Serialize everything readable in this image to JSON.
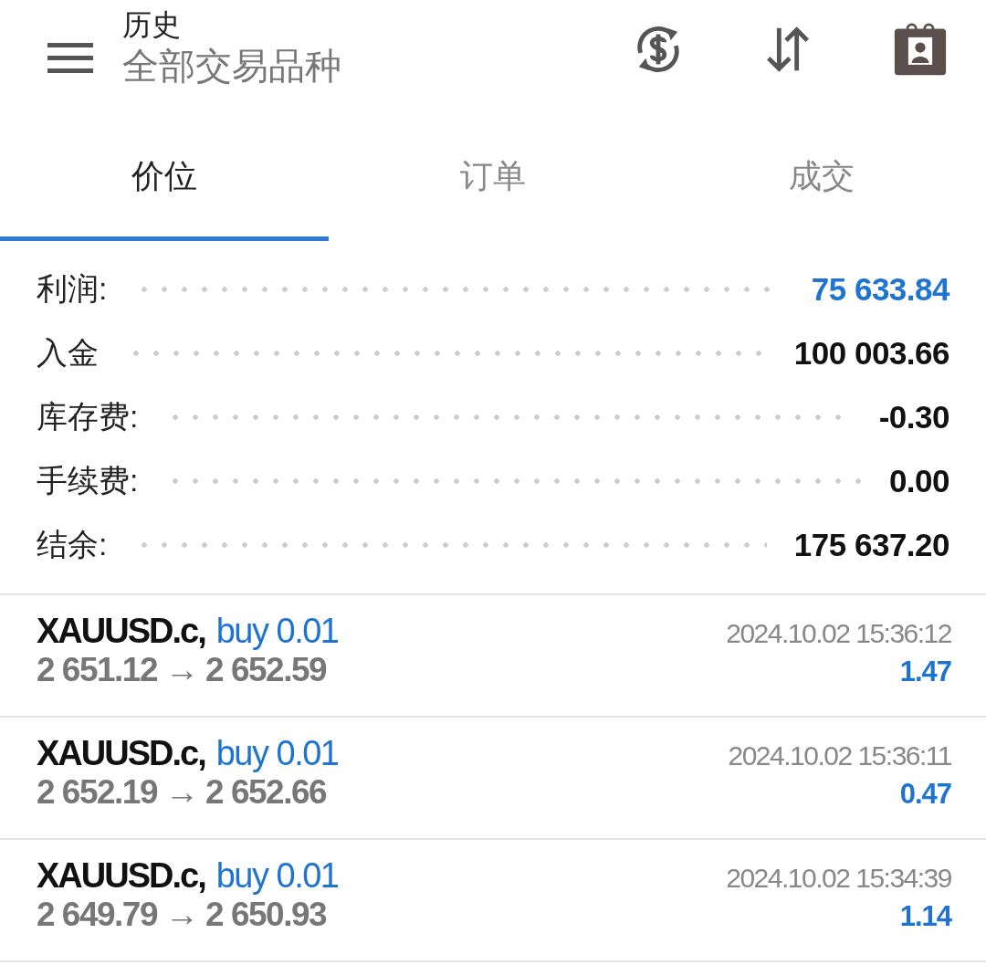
{
  "header": {
    "title": "历史",
    "subtitle": "全部交易品种"
  },
  "tabs": [
    {
      "label": "价位",
      "selected": true
    },
    {
      "label": "订单",
      "selected": false
    },
    {
      "label": "成交",
      "selected": false
    }
  ],
  "summary": [
    {
      "label": "利润:",
      "value": "75 633.84",
      "highlighted": true
    },
    {
      "label": "入金",
      "value": "100 003.66",
      "highlighted": false
    },
    {
      "label": "库存费:",
      "value": "-0.30",
      "highlighted": false
    },
    {
      "label": "手续费:",
      "value": "0.00",
      "highlighted": false
    },
    {
      "label": "结余:",
      "value": "175 637.20",
      "highlighted": false
    }
  ],
  "trades": [
    {
      "symbol": "XAUUSD.c,",
      "side": "buy 0.01",
      "prices": "2 651.12 → 2 652.59",
      "time": "2024.10.02 15:36:12",
      "profit": "1.47"
    },
    {
      "symbol": "XAUUSD.c,",
      "side": "buy 0.01",
      "prices": "2 652.19 → 2 652.66",
      "time": "2024.10.02 15:36:11",
      "profit": "0.47"
    },
    {
      "symbol": "XAUUSD.c,",
      "side": "buy 0.01",
      "prices": "2 649.79 → 2 650.93",
      "time": "2024.10.02 15:34:39",
      "profit": "1.14"
    }
  ]
}
